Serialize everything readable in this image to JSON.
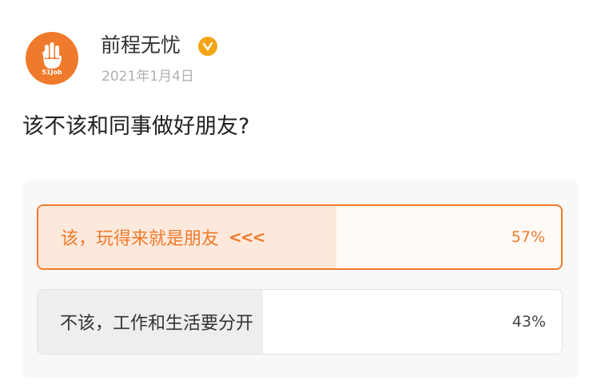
{
  "account": {
    "name": "前程无忧",
    "date": "2021年1月4日",
    "avatar_brand": "51Job",
    "avatar_icon": "hand-icon",
    "verified_icon": "verified-badge-icon",
    "brand_color": "#f07a2b",
    "verified_color": "#f3a515"
  },
  "post": {
    "question": "该不该和同事做好朋友?"
  },
  "poll": {
    "options": [
      {
        "label": "该，玩得来就是朋友",
        "percent_text": "57%",
        "percent": 57,
        "selected": true,
        "marker": "<<<"
      },
      {
        "label": "不该，工作和生活要分开",
        "percent_text": "43%",
        "percent": 43,
        "selected": false
      }
    ]
  }
}
